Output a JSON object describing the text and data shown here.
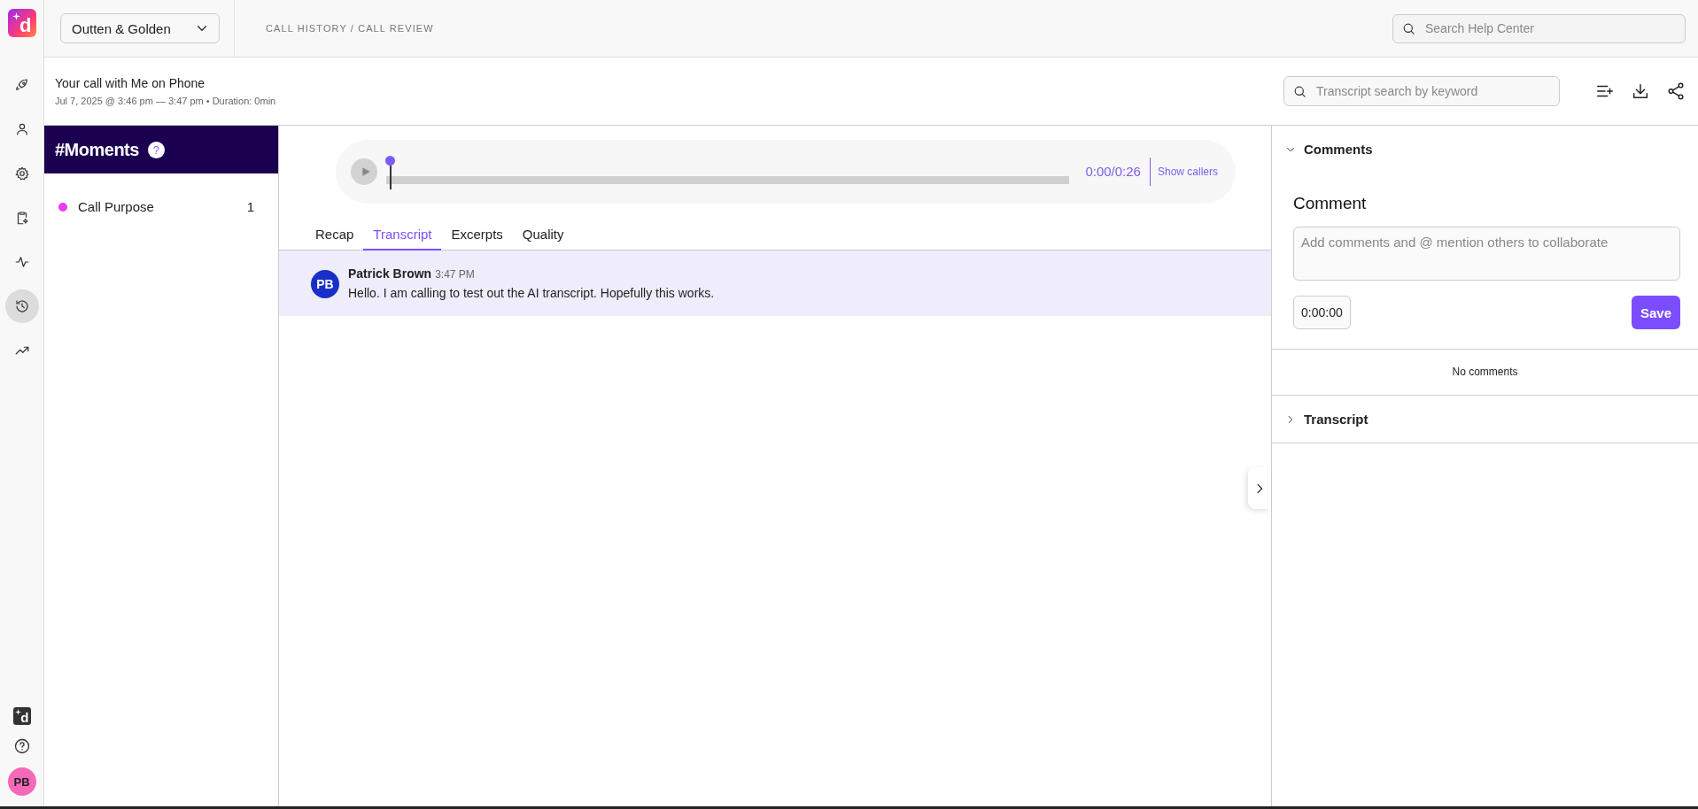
{
  "app": {
    "logo_letter": "d",
    "workspace": "Outten & Golden",
    "breadcrumb": "CALL HISTORY / CALL REVIEW",
    "help_search": {
      "placeholder": "Search Help Center"
    }
  },
  "nav": [
    {
      "selected": false
    },
    {
      "selected": false
    },
    {
      "selected": false
    },
    {
      "selected": false
    },
    {
      "selected": false
    },
    {
      "selected": true
    },
    {
      "selected": false
    }
  ],
  "nav_bottom": {
    "badge_letter": "d",
    "avatar": "PB"
  },
  "call": {
    "title": "Your call with Me on Phone",
    "meta": "Jul 7, 2025 @ 3:46 pm — 3:47 pm • Duration: 0min",
    "transcript_search": {
      "placeholder": "Transcript search by keyword"
    }
  },
  "moments": {
    "title": "#Moments",
    "help": "?",
    "items": [
      {
        "label": "Call Purpose",
        "count": "1",
        "color": "#e83cf0"
      }
    ]
  },
  "player": {
    "level": 0,
    "time": "0:00/0:26",
    "show_callers": "Show callers"
  },
  "tabs": [
    {
      "label": "Recap",
      "selected": false
    },
    {
      "label": "Transcript",
      "selected": true
    },
    {
      "label": "Excerpts",
      "selected": false
    },
    {
      "label": "Quality",
      "selected": false
    }
  ],
  "transcript": [
    {
      "initials": "PB",
      "speaker": "Patrick Brown",
      "time": "3:47 PM",
      "text": "Hello. I am calling to test out the AI transcript. Hopefully this works."
    }
  ],
  "comments_panel": {
    "title": "Comments",
    "expanded": true,
    "heading": "Comment",
    "input": {
      "placeholder": "Add comments and @ mention others to collaborate"
    },
    "timestamp": "0:00:00",
    "save": "Save",
    "empty": "No comments"
  },
  "transcript_panel": {
    "title": "Transcript",
    "expanded": false
  }
}
